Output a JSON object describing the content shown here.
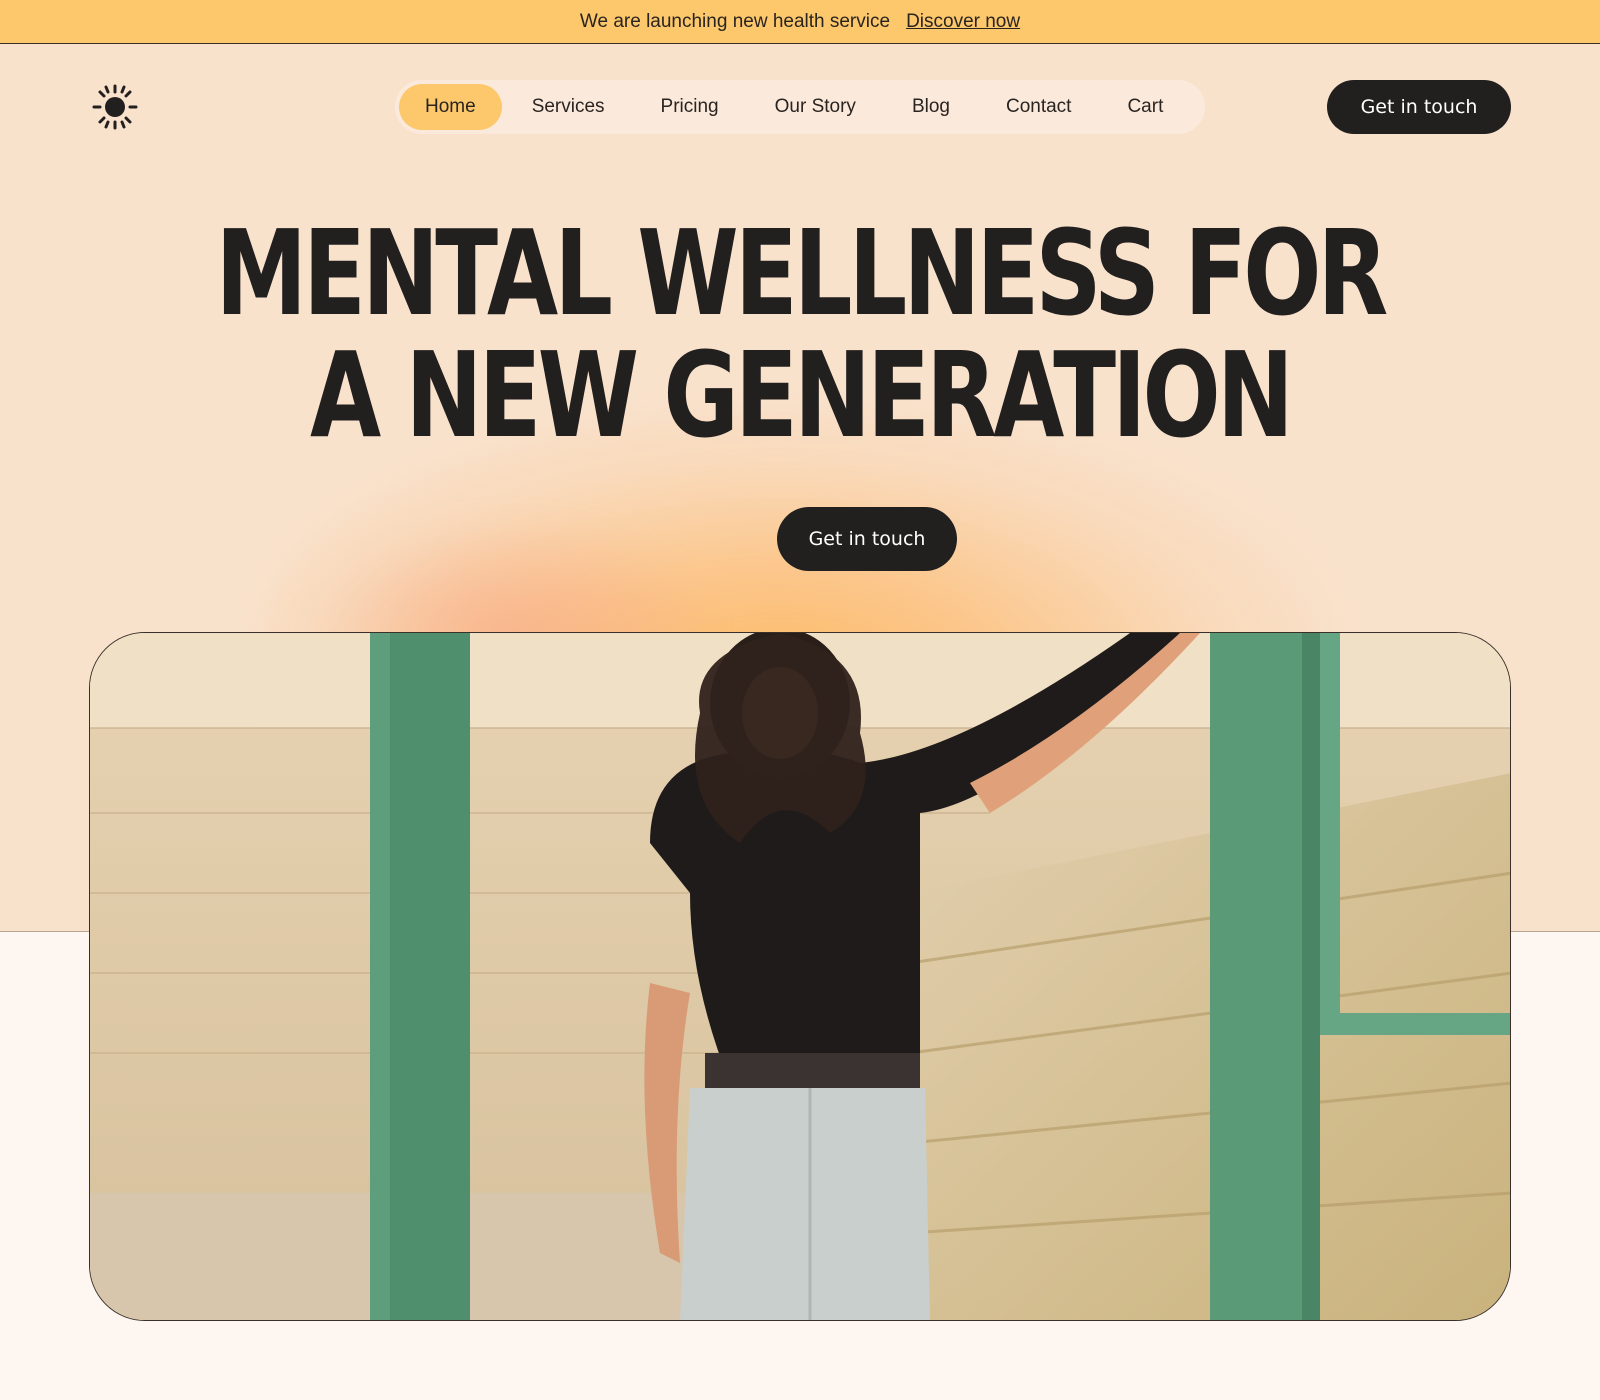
{
  "announcement": {
    "message": "We are launching new health service",
    "link": "Discover now"
  },
  "brand": {
    "logo_icon": "sun-icon"
  },
  "nav": {
    "items": [
      {
        "label": "Home",
        "active": true
      },
      {
        "label": "Services",
        "active": false
      },
      {
        "label": "Pricing",
        "active": false
      },
      {
        "label": "Our Story",
        "active": false
      },
      {
        "label": "Blog",
        "active": false
      },
      {
        "label": "Contact",
        "active": false
      },
      {
        "label": "Cart",
        "active": false
      }
    ]
  },
  "header": {
    "cta_label": "Get in touch"
  },
  "hero": {
    "headline_line1": "MENTAL WELLNESS FOR",
    "headline_line2": "A NEW GENERATION",
    "cta_label": "Get in touch"
  },
  "colors": {
    "announcement_bg": "#fcc86b",
    "hero_bg": "#f9e2cc",
    "nav_active": "#fcc86b",
    "dark": "#221f1f",
    "page_bg": "#fdf6f1"
  }
}
